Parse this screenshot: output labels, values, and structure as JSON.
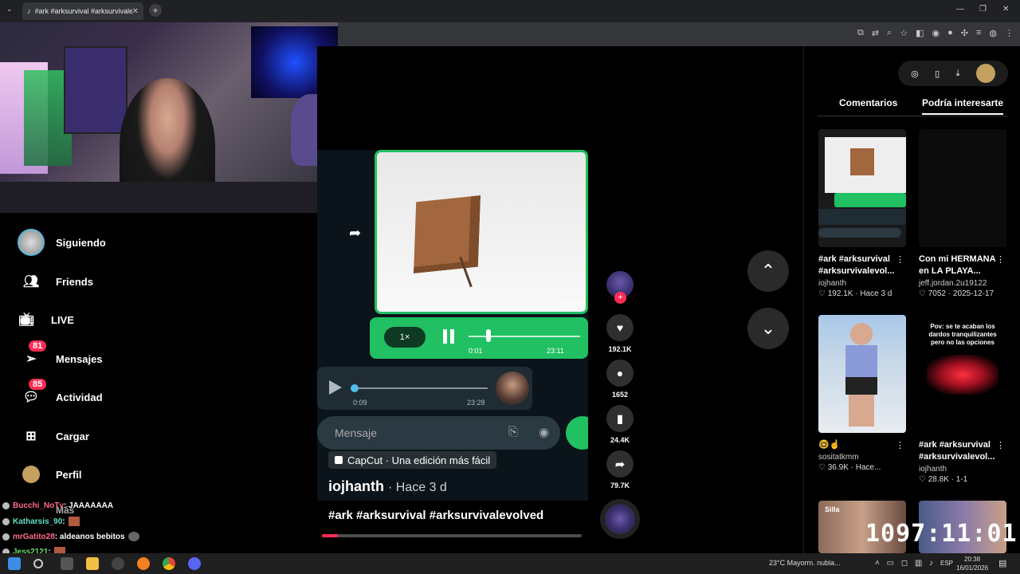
{
  "browser": {
    "tab_title": "#ark #arksurvival #arksurvivalev",
    "tab_close": "✕",
    "new_tab": "+",
    "window_controls": [
      "—",
      "❐",
      "✕"
    ]
  },
  "nav": {
    "items": [
      {
        "label": "Siguiendo",
        "icon": "following-avatar-icon"
      },
      {
        "label": "Friends",
        "icon": "friends-icon"
      },
      {
        "label": "LIVE",
        "icon": "live-tv-icon"
      },
      {
        "label": "Mensajes",
        "icon": "messages-icon",
        "badge": "81"
      },
      {
        "label": "Actividad",
        "icon": "activity-icon",
        "badge": "85"
      },
      {
        "label": "Cargar",
        "icon": "upload-icon"
      },
      {
        "label": "Perfil",
        "icon": "profile-icon"
      }
    ],
    "more": "Más"
  },
  "chat": [
    {
      "user": "Bucchi_NoTv",
      "color": "#ff6b8b",
      "msg": ": JAAAAAAA"
    },
    {
      "user": "Katharsis_90",
      "color": "#5fe0c8",
      "msg": ":"
    },
    {
      "user": "mrGatito28",
      "color": "#ff6b8b",
      "msg": ": aldeanos bebitos"
    },
    {
      "user": "Jess2121",
      "color": "#6fe06f",
      "msg": ":"
    }
  ],
  "video": {
    "image_time": "23:11",
    "voice1": {
      "speed": "1×",
      "elapsed": "0:01",
      "time": "23:11"
    },
    "voice2": {
      "elapsed": "0:09",
      "time": "23:28"
    },
    "input_placeholder": "Mensaje",
    "capcut": "CapCut · Una edición más fácil",
    "author": "iojhanth",
    "posted": "· Hace 3 d",
    "caption": "#ark #arksurvival #arksurvivalevolved",
    "progress": 0.06
  },
  "actions": {
    "likes": "192.1K",
    "comments": "1652",
    "saves": "24.4K",
    "shares": "79.7K"
  },
  "panel": {
    "tabs": [
      "Comentarios",
      "Podría interesarte"
    ],
    "active_tab": 1,
    "cards": [
      {
        "title": "#ark #arksurvival #arksurvivalevol...",
        "user": "iojhanth",
        "meta": "♡ 192.1K · Hace 3 d",
        "thumb": "box-video"
      },
      {
        "title": "Con mi HERMANA en LA PLAYA...",
        "user": "jeff.jordan.2u19122",
        "meta": "♡ 7052 · 2025-12-17",
        "thumb": "dark"
      },
      {
        "title": "🤓☝️",
        "user": "sositatkmm",
        "meta": "♡ 36.9K · Hace...",
        "thumb": "girl"
      },
      {
        "title": "#ark #arksurvival #arksurvivalevol...",
        "user": "iojhanth",
        "meta": "♡ 28.8K · 1-1",
        "thumb": "dino",
        "overlay": "Pov: se te acaban los dardos tranquilizantes pero no las opciones"
      },
      {
        "title": "",
        "user": "",
        "meta": "",
        "thumb": "people",
        "overlay": "Silla"
      },
      {
        "title": "",
        "user": "",
        "meta": "",
        "thumb": "people2"
      }
    ]
  },
  "stream_timer": "1097:11:01",
  "taskbar": {
    "weather": "23°C  Mayorm. nubla...",
    "lang": "ESP",
    "time": "20:38",
    "date": "16/01/2026"
  }
}
